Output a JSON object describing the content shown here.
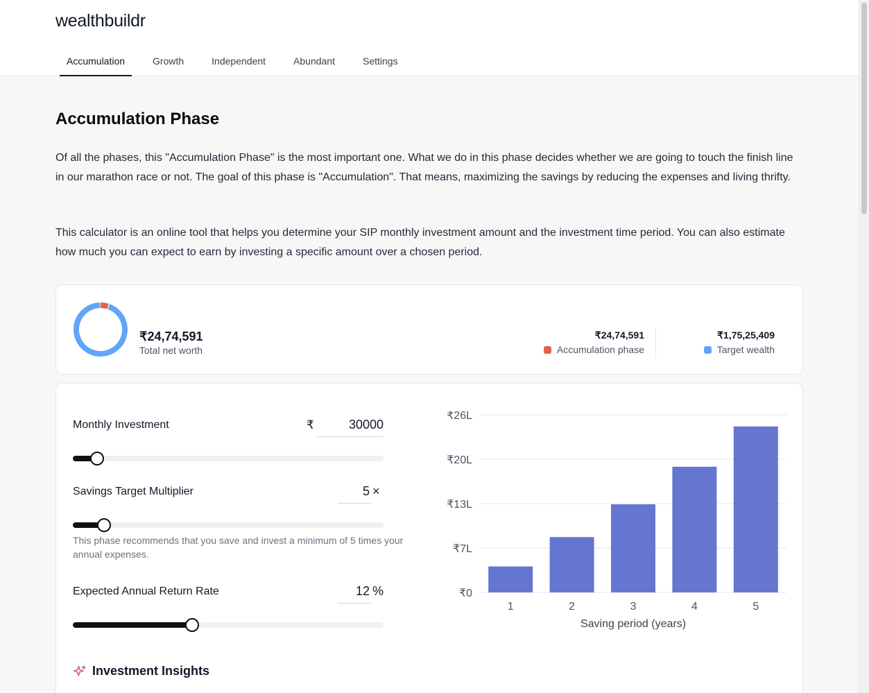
{
  "app": {
    "brand": "wealthbuildr"
  },
  "nav": {
    "tabs": [
      "Accumulation",
      "Growth",
      "Independent",
      "Abundant",
      "Settings"
    ],
    "active": "Accumulation"
  },
  "page": {
    "title": "Accumulation Phase",
    "intro_1": "Of all the phases, this \"Accumulation Phase\" is the most important one. What we do in this phase decides whether we are going to touch the finish line in our marathon race or not. The goal of this phase is \"Accumulation\". That means, maximizing the savings by reducing the expenses and living thrifty.",
    "intro_2": "This calculator is an online tool that helps you determine your SIP monthly investment amount and the investment time period. You can also estimate how much you can expect to earn by investing a specific amount over a chosen period."
  },
  "summary": {
    "total_net_worth": "₹24,74,591",
    "total_net_worth_label": "Total net worth",
    "accumulation_value": "₹24,74,591",
    "accumulation_label": "Accumulation phase",
    "target_value": "₹1,75,25,409",
    "target_label": "Target wealth",
    "accumulation_color": "#e4634a",
    "target_color": "#60a5fa",
    "donut_accumulation_fraction": 0.055
  },
  "calculator": {
    "monthly_investment": {
      "label": "Monthly Investment",
      "currency": "₹",
      "value": "30000",
      "slider_fraction": 0.078
    },
    "multiplier": {
      "label": "Savings Target Multiplier",
      "value": "5",
      "suffix": "×",
      "slider_fraction": 0.1,
      "hint": "This phase recommends that you save and invest a minimum of 5 times your annual expenses."
    },
    "return_rate": {
      "label": "Expected Annual Return Rate",
      "value": "12",
      "suffix": "%",
      "slider_fraction": 0.385
    }
  },
  "insights": {
    "title": "Investment Insights"
  },
  "chart_data": {
    "type": "bar",
    "categories": [
      "1",
      "2",
      "3",
      "4",
      "5"
    ],
    "values": [
      3.8,
      8.1,
      12.9,
      18.4,
      24.3
    ],
    "value_unit": "₹ lakh",
    "ytick_labels": [
      "₹0",
      "₹7L",
      "₹13L",
      "₹20L",
      "₹26L"
    ],
    "ylim": [
      0,
      26
    ],
    "xlabel": "Saving period (years)",
    "bar_color": "#6476d0",
    "grid": true
  }
}
